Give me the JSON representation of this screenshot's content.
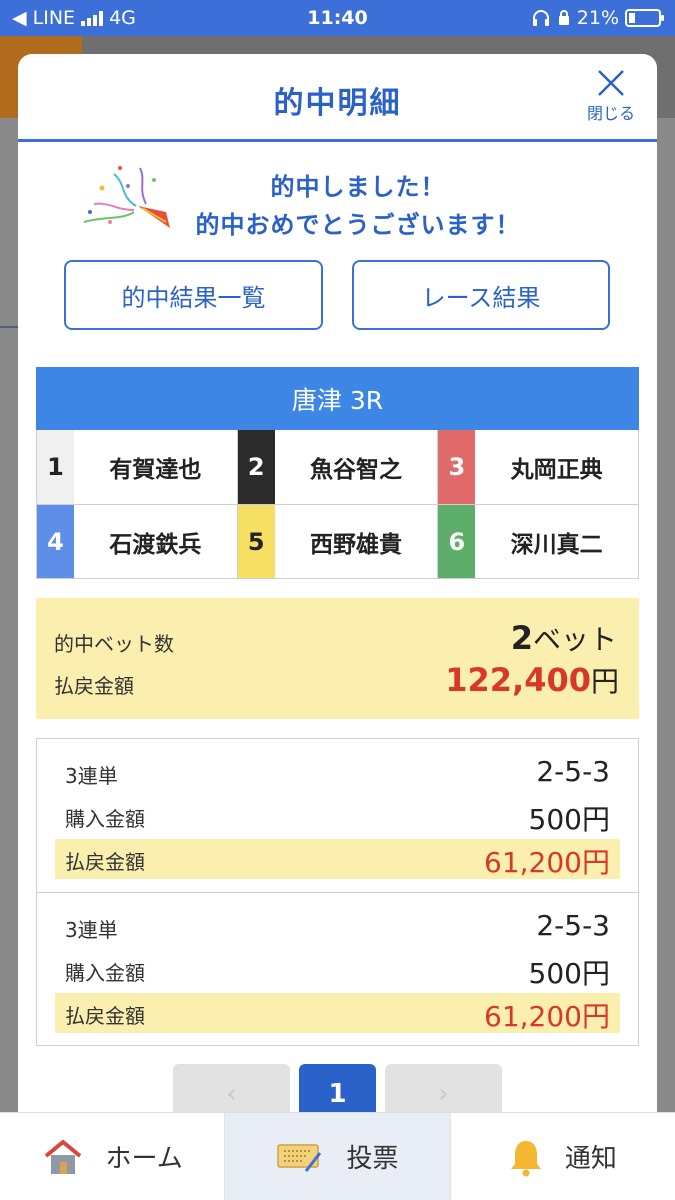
{
  "status_bar": {
    "back_app": "◀ LINE",
    "network": "4G",
    "time": "11:40",
    "battery": "21%"
  },
  "modal": {
    "title": "的中明細",
    "close_label": "閉じる",
    "congrats_line1": "的中しました！",
    "congrats_line2": "的中おめでとうございます！",
    "btn_results": "的中結果一覧",
    "btn_race": "レース結果"
  },
  "race": {
    "name": "唐津 3R",
    "racers": [
      {
        "num": "1",
        "name": "有賀達也",
        "bg": "#f0f0f0",
        "fg": "#222222"
      },
      {
        "num": "2",
        "name": "魚谷智之",
        "bg": "#2b2b2b",
        "fg": "#ffffff"
      },
      {
        "num": "3",
        "name": "丸岡正典",
        "bg": "#e16a6a",
        "fg": "#ffffff"
      },
      {
        "num": "4",
        "name": "石渡鉄兵",
        "bg": "#5d8fe8",
        "fg": "#ffffff"
      },
      {
        "num": "5",
        "name": "西野雄貴",
        "bg": "#f6e063",
        "fg": "#222222"
      },
      {
        "num": "6",
        "name": "深川真二",
        "bg": "#5cae6a",
        "fg": "#ffffff"
      }
    ]
  },
  "summary": {
    "bet_count_label": "的中ベット数",
    "bet_count_value": "2",
    "bet_count_unit": "ベット",
    "payout_label": "払戻金額",
    "payout_value": "122,400",
    "payout_unit": "円"
  },
  "bets": [
    {
      "type": "3連単",
      "combo": "2-5-3",
      "purchase_label": "購入金額",
      "purchase": "500円",
      "payout_label": "払戻金額",
      "payout": "61,200円"
    },
    {
      "type": "3連単",
      "combo": "2-5-3",
      "purchase_label": "購入金額",
      "purchase": "500円",
      "payout_label": "払戻金額",
      "payout": "61,200円"
    }
  ],
  "pager": {
    "prev": "‹",
    "current": "1",
    "next": "›"
  },
  "tabs": [
    {
      "label": "ホーム",
      "icon": "home-icon"
    },
    {
      "label": "投票",
      "icon": "ticket-icon"
    },
    {
      "label": "通知",
      "icon": "bell-icon"
    }
  ],
  "colors": {
    "primary": "#2a62c9",
    "race_header": "#3d86e6",
    "highlight": "#fbefb0",
    "payout": "#d8382a"
  }
}
